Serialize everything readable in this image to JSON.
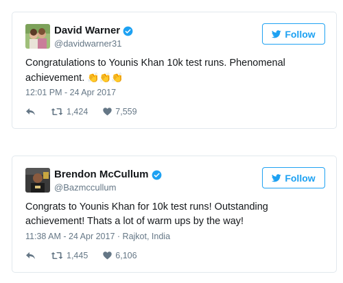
{
  "tweets": [
    {
      "display_name": "David Warner",
      "handle": "@davidwarner31",
      "follow_label": "Follow",
      "text": "Congratulations to Younis Khan 10k test runs. Phenomenal achievement.",
      "emoji": "👏👏👏",
      "timestamp": "12:01 PM - 24 Apr 2017",
      "location": "",
      "retweets": "1,424",
      "likes": "7,559",
      "verified": true
    },
    {
      "display_name": "Brendon McCullum",
      "handle": "@Bazmccullum",
      "follow_label": "Follow",
      "text": "Congrats to Younis Khan for 10k test runs! Outstanding achievement! Thats a lot of warm ups by the way!",
      "emoji": "",
      "timestamp": "11:38 AM - 24 Apr 2017",
      "location": "Rajkot, India",
      "retweets": "1,445",
      "likes": "6,106",
      "verified": true
    }
  ],
  "colors": {
    "accent": "#1da1f2",
    "text": "#14171a",
    "muted": "#657786",
    "border": "#e1e8ed",
    "heart": "#657786"
  },
  "icons": [
    "verified-icon",
    "bird-icon",
    "reply-icon",
    "retweet-icon",
    "heart-icon"
  ]
}
